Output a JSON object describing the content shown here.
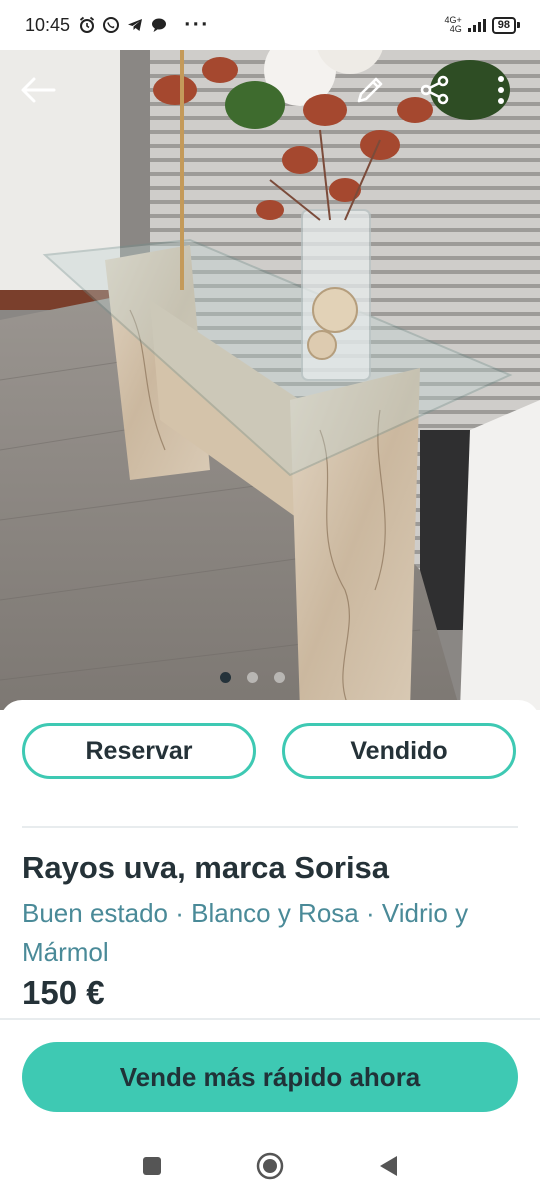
{
  "status_bar": {
    "time": "10:45",
    "network_top": "4G+",
    "network_bottom": "4G",
    "battery": "98",
    "icons": [
      "alarm-icon",
      "whatsapp-icon",
      "telegram-icon",
      "chat-icon"
    ],
    "more": "···"
  },
  "photo": {
    "icons": {
      "back": "back-arrow-icon",
      "edit": "pencil-icon",
      "share": "share-icon",
      "menu": "more-vertical-icon"
    },
    "image_count": 3,
    "active_index": 0
  },
  "actions": {
    "reserve_label": "Reservar",
    "sold_label": "Vendido"
  },
  "listing": {
    "title": "Rayos uva, marca Sorisa",
    "details": "Buen estado · Blanco y Rosa · Vidrio y Mármol",
    "price": "150 €"
  },
  "cta": {
    "label": "Vende más rápido ahora"
  },
  "colors": {
    "accent": "#3ec9b3",
    "text_dark": "#253238",
    "text_secondary": "#4a8a98"
  },
  "navbar": {
    "icons": [
      "recents-icon",
      "home-icon",
      "back-icon"
    ]
  }
}
